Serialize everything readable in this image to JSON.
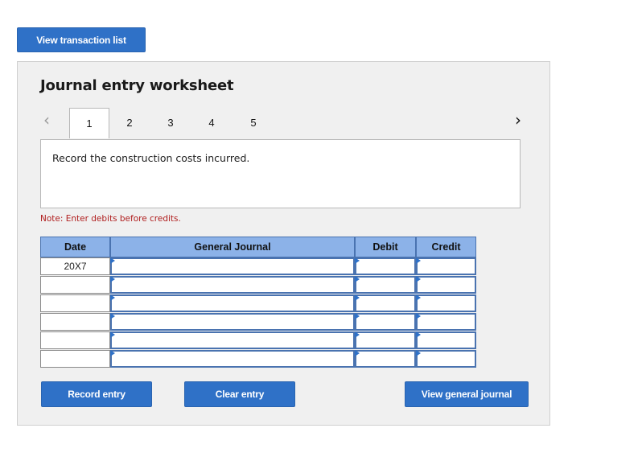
{
  "top_button": {
    "label": "View transaction list"
  },
  "worksheet": {
    "title": "Journal entry worksheet",
    "prev_icon": "chevron-left-icon",
    "next_icon": "chevron-right-icon",
    "tabs": [
      {
        "label": "1",
        "active": true
      },
      {
        "label": "2",
        "active": false
      },
      {
        "label": "3",
        "active": false
      },
      {
        "label": "4",
        "active": false
      },
      {
        "label": "5",
        "active": false
      }
    ],
    "instruction": "Record the construction costs incurred.",
    "note": "Note: Enter debits before credits."
  },
  "table": {
    "headers": {
      "date": "Date",
      "journal": "General Journal",
      "debit": "Debit",
      "credit": "Credit"
    },
    "rows": [
      {
        "date": "20X7",
        "journal": "",
        "debit": "",
        "credit": ""
      },
      {
        "date": "",
        "journal": "",
        "debit": "",
        "credit": ""
      },
      {
        "date": "",
        "journal": "",
        "debit": "",
        "credit": ""
      },
      {
        "date": "",
        "journal": "",
        "debit": "",
        "credit": ""
      },
      {
        "date": "",
        "journal": "",
        "debit": "",
        "credit": ""
      },
      {
        "date": "",
        "journal": "",
        "debit": "",
        "credit": ""
      }
    ]
  },
  "actions": {
    "record": "Record entry",
    "clear": "Clear entry",
    "view_journal": "View general journal"
  },
  "colors": {
    "primary_button": "#2f71c7",
    "table_header": "#8cb2e8",
    "input_border": "#4a73b0",
    "note_text": "#b01e1e",
    "panel_bg": "#f0f0f0"
  }
}
